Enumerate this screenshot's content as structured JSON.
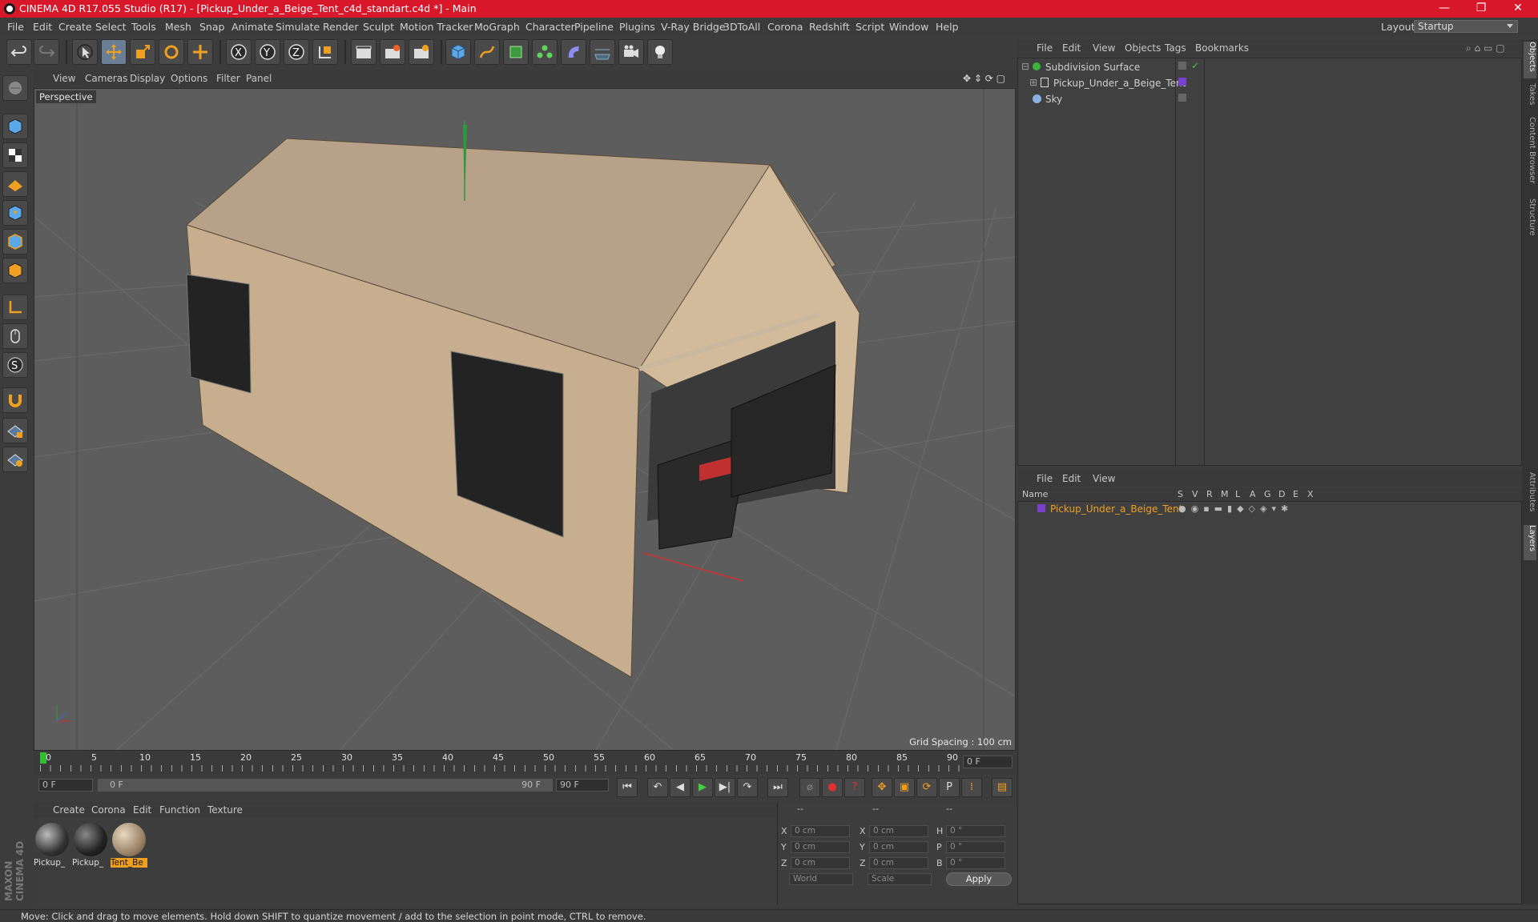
{
  "window": {
    "title": "CINEMA 4D R17.055 Studio (R17) - [Pickup_Under_a_Beige_Tent_c4d_standart.c4d *] - Main",
    "minimize": "—",
    "maximize": "❐",
    "close": "✕"
  },
  "menu": [
    "File",
    "Edit",
    "Create",
    "Select",
    "Tools",
    "Mesh",
    "Snap",
    "Animate",
    "Simulate",
    "Render",
    "Sculpt",
    "Motion Tracker",
    "MoGraph",
    "Character",
    "Pipeline",
    "Plugins",
    "V-Ray Bridge",
    "3DToAll",
    "Corona",
    "Redshift",
    "Script",
    "Window",
    "Help"
  ],
  "layout": {
    "label": "Layout:",
    "value": "Startup"
  },
  "viewport": {
    "menu": [
      "View",
      "Cameras",
      "Display",
      "Options",
      "Filter",
      "Panel"
    ],
    "camera_label": "Perspective",
    "grid_spacing": "Grid Spacing : 100 cm"
  },
  "timeline": {
    "ticks": [
      "0",
      "5",
      "10",
      "15",
      "20",
      "25",
      "30",
      "35",
      "40",
      "45",
      "50",
      "55",
      "60",
      "65",
      "70",
      "75",
      "80",
      "85",
      "90"
    ],
    "end_frame_field": "0 F"
  },
  "playback": {
    "start_field": "0 F",
    "range_start": "0 F",
    "range_end": "90 F",
    "end_field": "90 F"
  },
  "material_manager": {
    "menu": [
      "Create",
      "Corona",
      "Edit",
      "Function",
      "Texture"
    ],
    "materials": [
      {
        "label": "Pickup_",
        "selected": false
      },
      {
        "label": "Pickup_",
        "selected": false
      },
      {
        "label": "Tent_Be",
        "selected": true
      }
    ]
  },
  "coordinates": {
    "headers": [
      "--",
      "--",
      "--"
    ],
    "rows": [
      {
        "a": "X",
        "av": "0 cm",
        "b": "X",
        "bv": "0 cm",
        "c": "H",
        "cv": "0 °"
      },
      {
        "a": "Y",
        "av": "0 cm",
        "b": "Y",
        "bv": "0 cm",
        "c": "P",
        "cv": "0 °"
      },
      {
        "a": "Z",
        "av": "0 cm",
        "b": "Z",
        "bv": "0 cm",
        "c": "B",
        "cv": "0 °"
      }
    ],
    "mode1": "World",
    "mode2": "Scale",
    "apply": "Apply"
  },
  "object_manager": {
    "menu": [
      "File",
      "Edit",
      "View",
      "Objects",
      "Tags",
      "Bookmarks"
    ],
    "objects": [
      {
        "name": "Subdivision Surface",
        "indent": 0
      },
      {
        "name": "Pickup_Under_a_Beige_Tent",
        "indent": 1
      },
      {
        "name": "Sky",
        "indent": 0
      }
    ]
  },
  "layer_manager": {
    "menu": [
      "File",
      "Edit",
      "View"
    ],
    "columns": [
      "Name",
      "S",
      "V",
      "R",
      "M",
      "L",
      "A",
      "G",
      "D",
      "E",
      "X"
    ],
    "layers": [
      {
        "name": "Pickup_Under_a_Beige_Tent"
      }
    ]
  },
  "right_tabs": [
    "Objects",
    "Takes",
    "Content Browser",
    "Structure",
    "Attributes",
    "Layers"
  ],
  "status": "Move: Click and drag to move elements. Hold down SHIFT to quantize movement / add to the selection in point mode, CTRL to remove.",
  "colors": {
    "accent": "#d8182a",
    "selection_orange": "#f0a020",
    "layer_purple": "#7a3fd0"
  }
}
